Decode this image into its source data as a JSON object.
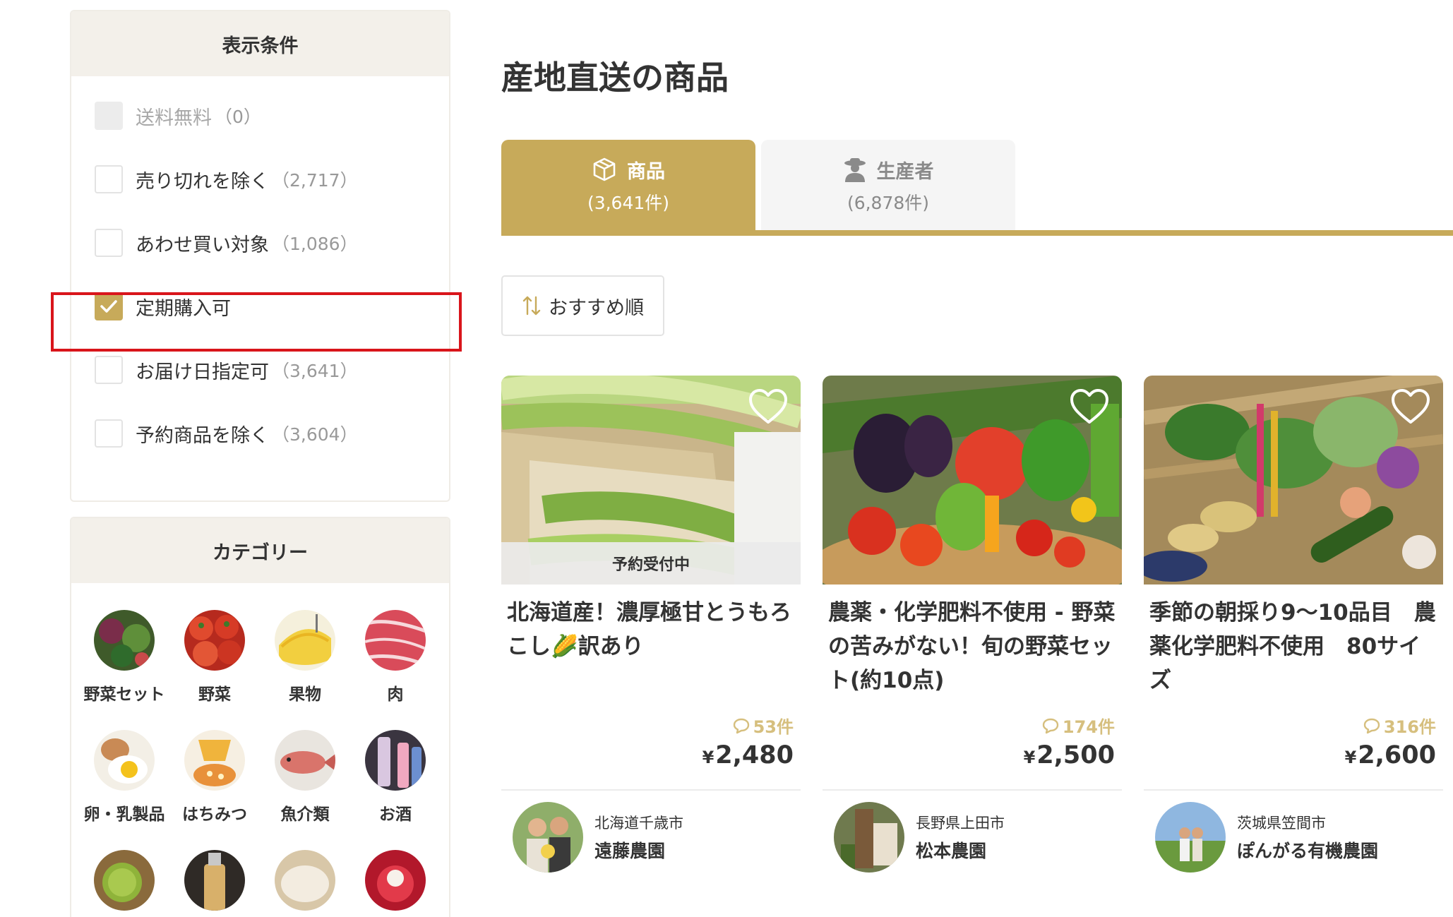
{
  "sidebar": {
    "filter_title": "表示条件",
    "filters": [
      {
        "label": "送料無料",
        "count": "（0）",
        "state": "disabled"
      },
      {
        "label": "売り切れを除く",
        "count": "（2,717）",
        "state": "unchecked"
      },
      {
        "label": "あわせ買い対象",
        "count": "（1,086）",
        "state": "unchecked"
      },
      {
        "label": "定期購入可",
        "count": "",
        "state": "checked"
      },
      {
        "label": "お届け日指定可",
        "count": "（3,641）",
        "state": "unchecked"
      },
      {
        "label": "予約商品を除く",
        "count": "（3,604）",
        "state": "unchecked"
      }
    ],
    "category_title": "カテゴリー",
    "categories": [
      {
        "label": "野菜セット",
        "icon": "vegetable-set-photo"
      },
      {
        "label": "野菜",
        "icon": "tomato-photo"
      },
      {
        "label": "果物",
        "icon": "melon-photo"
      },
      {
        "label": "肉",
        "icon": "meat-photo"
      },
      {
        "label": "卵・乳製品",
        "icon": "egg-photo"
      },
      {
        "label": "はちみつ",
        "icon": "honey-photo"
      },
      {
        "label": "魚介類",
        "icon": "fish-photo"
      },
      {
        "label": "お酒",
        "icon": "sake-photo"
      },
      {
        "label": "",
        "icon": "tea-photo"
      },
      {
        "label": "",
        "icon": "bottle-photo"
      },
      {
        "label": "",
        "icon": "rice-photo"
      },
      {
        "label": "",
        "icon": "sweets-photo"
      }
    ]
  },
  "main": {
    "title": "産地直送の商品",
    "tabs": [
      {
        "label": "商品",
        "count": "(3,641件)",
        "icon": "box-icon",
        "active": true
      },
      {
        "label": "生産者",
        "count": "(6,878件)",
        "icon": "farmer-icon",
        "active": false
      }
    ],
    "sort_label": "おすすめ順",
    "products": [
      {
        "title": "北海道産！濃厚極甘とうもろこし🌽訳あり",
        "badge": "予約受付中",
        "reviews": "53件",
        "yen": "¥",
        "price": "2,480",
        "producer_location": "北海道千歳市",
        "producer_name": "遠藤農園"
      },
      {
        "title": "農薬・化学肥料不使用 - 野菜の苦みがない！旬の野菜セット(約10点)",
        "badge": "",
        "reviews": "174件",
        "yen": "¥",
        "price": "2,500",
        "producer_location": "長野県上田市",
        "producer_name": "松本農園"
      },
      {
        "title": "季節の朝採り9～10品目　農薬化学肥料不使用　80サイズ",
        "badge": "",
        "reviews": "316件",
        "yen": "¥",
        "price": "2,600",
        "producer_location": "茨城県笠間市",
        "producer_name": "ぽんがる有機農園"
      }
    ]
  },
  "colors": {
    "accent": "#c7aa5a",
    "highlight": "#d9151b",
    "review": "#d6bf7e"
  }
}
